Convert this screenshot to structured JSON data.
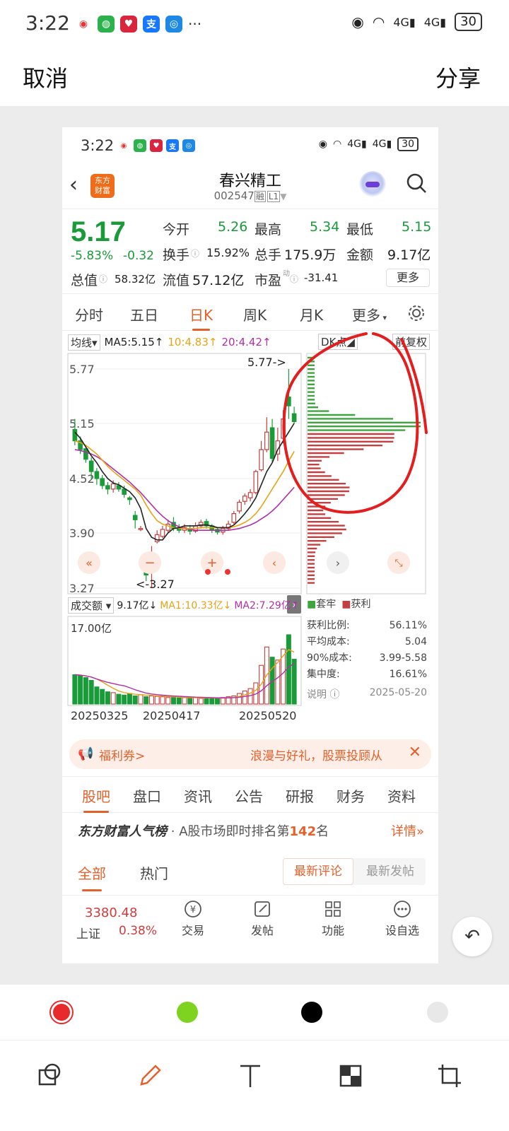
{
  "outer_status": {
    "time": "3:22",
    "battery": "30",
    "more": "···"
  },
  "topbar": {
    "cancel": "取消",
    "share": "分享"
  },
  "inner_status": {
    "time": "3:22",
    "battery": "30"
  },
  "stock": {
    "brand_line1": "东方",
    "brand_line2": "财富",
    "name": "春兴精工",
    "code": "002547",
    "tag": "融",
    "level": "L1"
  },
  "quote": {
    "price": "5.17",
    "change_pct": "-5.83%",
    "change": "-0.32",
    "open_label": "今开",
    "open": "5.26",
    "high_label": "最高",
    "high": "5.34",
    "low_label": "最低",
    "low": "5.15",
    "turnover_label": "换手",
    "turnover": "15.92%",
    "volume_label": "总手",
    "volume": "175.9万",
    "amount_label": "金额",
    "amount": "9.17亿",
    "mcap_label": "总值",
    "mcap": "58.32亿",
    "float_label": "流值",
    "float": "57.12亿",
    "pe_label": "市盈",
    "pe_sup": "动",
    "pe": "-31.41",
    "more": "更多"
  },
  "ktabs": [
    "分时",
    "五日",
    "日K",
    "周K",
    "月K",
    "更多"
  ],
  "ktab_active": "日K",
  "ma": {
    "select": "均线",
    "ma5": "MA5:5.15",
    "ma10": "10:4.83",
    "ma20": "20:4.42"
  },
  "dk": {
    "select": "DK点",
    "fq": "前复权"
  },
  "chart_data": {
    "type": "candlestick",
    "y_ticks": [
      "5.77",
      "5.15",
      "4.52",
      "3.90",
      "3.27"
    ],
    "max_label": "5.77->",
    "min_label": "<-3.27",
    "x_ticks": [
      "20250325",
      "20250417",
      "20250520"
    ],
    "candles": [
      {
        "o": 5.08,
        "c": 4.95,
        "h": 5.2,
        "l": 4.9
      },
      {
        "o": 4.95,
        "c": 4.85,
        "h": 5.0,
        "l": 4.8
      },
      {
        "o": 4.86,
        "c": 4.74,
        "h": 4.9,
        "l": 4.7
      },
      {
        "o": 4.72,
        "c": 4.6,
        "h": 4.76,
        "l": 4.52
      },
      {
        "o": 4.6,
        "c": 4.52,
        "h": 4.64,
        "l": 4.45
      },
      {
        "o": 4.52,
        "c": 4.44,
        "h": 4.56,
        "l": 4.4
      },
      {
        "o": 4.44,
        "c": 4.4,
        "h": 4.48,
        "l": 4.34
      },
      {
        "o": 4.4,
        "c": 4.46,
        "h": 4.5,
        "l": 4.36
      },
      {
        "o": 4.44,
        "c": 4.4,
        "h": 4.48,
        "l": 4.37
      },
      {
        "o": 4.4,
        "c": 4.34,
        "h": 4.44,
        "l": 4.3
      },
      {
        "o": 4.3,
        "c": 4.28,
        "h": 4.32,
        "l": 4.22
      },
      {
        "o": 4.1,
        "c": 4.05,
        "h": 4.15,
        "l": 3.95
      },
      {
        "o": 3.95,
        "c": 3.95,
        "h": 3.98,
        "l": 3.92
      },
      {
        "o": 3.55,
        "c": 3.42,
        "h": 3.6,
        "l": 3.35
      },
      {
        "o": 3.45,
        "c": 3.62,
        "h": 3.75,
        "l": 3.27
      },
      {
        "o": 3.8,
        "c": 3.88,
        "h": 3.93,
        "l": 3.78
      },
      {
        "o": 3.86,
        "c": 3.94,
        "h": 3.98,
        "l": 3.84
      },
      {
        "o": 3.93,
        "c": 4.0,
        "h": 4.05,
        "l": 3.9
      },
      {
        "o": 4.02,
        "c": 3.95,
        "h": 4.08,
        "l": 3.92
      },
      {
        "o": 3.96,
        "c": 3.93,
        "h": 4.0,
        "l": 3.9
      },
      {
        "o": 3.93,
        "c": 3.96,
        "h": 4.0,
        "l": 3.9
      },
      {
        "o": 3.95,
        "c": 3.92,
        "h": 3.99,
        "l": 3.88
      },
      {
        "o": 3.92,
        "c": 3.98,
        "h": 4.02,
        "l": 3.9
      },
      {
        "o": 3.98,
        "c": 4.02,
        "h": 4.05,
        "l": 3.95
      },
      {
        "o": 4.03,
        "c": 3.98,
        "h": 4.06,
        "l": 3.95
      },
      {
        "o": 3.98,
        "c": 3.93,
        "h": 4.0,
        "l": 3.9
      },
      {
        "o": 3.94,
        "c": 3.91,
        "h": 3.96,
        "l": 3.88
      },
      {
        "o": 3.91,
        "c": 3.95,
        "h": 3.98,
        "l": 3.88
      },
      {
        "o": 3.95,
        "c": 4.0,
        "h": 4.04,
        "l": 3.93
      },
      {
        "o": 4.02,
        "c": 4.12,
        "h": 4.15,
        "l": 4.0
      },
      {
        "o": 4.15,
        "c": 4.25,
        "h": 4.28,
        "l": 4.12
      },
      {
        "o": 4.26,
        "c": 4.32,
        "h": 4.35,
        "l": 4.22
      },
      {
        "o": 4.3,
        "c": 4.36,
        "h": 4.4,
        "l": 4.26
      },
      {
        "o": 4.36,
        "c": 4.6,
        "h": 4.62,
        "l": 4.34
      },
      {
        "o": 4.62,
        "c": 4.85,
        "h": 4.95,
        "l": 4.6
      },
      {
        "o": 4.85,
        "c": 5.05,
        "h": 5.22,
        "l": 4.82
      },
      {
        "o": 5.1,
        "c": 4.75,
        "h": 5.2,
        "l": 4.7
      },
      {
        "o": 4.8,
        "c": 4.95,
        "h": 5.1,
        "l": 4.72
      },
      {
        "o": 4.98,
        "c": 5.2,
        "h": 5.3,
        "l": 4.92
      },
      {
        "o": 5.45,
        "c": 5.35,
        "h": 5.77,
        "l": 5.2
      },
      {
        "o": 5.26,
        "c": 5.17,
        "h": 5.34,
        "l": 5.15
      }
    ],
    "ma5": [
      5.05,
      4.98,
      4.88,
      4.78,
      4.7,
      4.6,
      4.52,
      4.47,
      4.45,
      4.41,
      4.37,
      4.3,
      4.18,
      3.95,
      3.85,
      3.82,
      3.82,
      3.9,
      3.95,
      3.96,
      3.98,
      3.98,
      3.98,
      3.99,
      3.99,
      3.98,
      3.96,
      3.96,
      3.96,
      3.99,
      4.05,
      4.12,
      4.2,
      4.3,
      4.45,
      4.6,
      4.7,
      4.85,
      4.95,
      5.05,
      5.15
    ],
    "ma10": [
      4.95,
      4.93,
      4.9,
      4.85,
      4.8,
      4.73,
      4.66,
      4.6,
      4.55,
      4.5,
      4.45,
      4.4,
      4.33,
      4.22,
      4.12,
      4.04,
      4.0,
      3.98,
      3.96,
      3.95,
      3.95,
      3.95,
      3.95,
      3.96,
      3.96,
      3.96,
      3.96,
      3.96,
      3.96,
      3.97,
      3.99,
      4.02,
      4.06,
      4.12,
      4.2,
      4.3,
      4.4,
      4.5,
      4.6,
      4.72,
      4.83
    ],
    "ma20": [
      4.85,
      4.84,
      4.82,
      4.8,
      4.77,
      4.73,
      4.68,
      4.63,
      4.58,
      4.53,
      4.48,
      4.42,
      4.36,
      4.29,
      4.22,
      4.15,
      4.09,
      4.04,
      4.0,
      3.97,
      3.95,
      3.94,
      3.93,
      3.93,
      3.93,
      3.93,
      3.93,
      3.93,
      3.93,
      3.94,
      3.95,
      3.97,
      3.99,
      4.02,
      4.06,
      4.1,
      4.15,
      4.21,
      4.28,
      4.35,
      4.42
    ],
    "volume_label": "成交额",
    "volume_value": "9.17亿",
    "vol_ma1": "MA1:10.33亿",
    "vol_ma2": "MA2:7.29亿",
    "volume_axis_max": "17.00亿",
    "volumes": [
      7.2,
      7.0,
      6.5,
      5.8,
      4.2,
      3.6,
      3.0,
      2.8,
      2.4,
      2.2,
      2.6,
      2.0,
      2.3,
      1.8,
      2.0,
      1.9,
      1.8,
      1.6,
      1.7,
      1.5,
      1.6,
      1.5,
      1.6,
      1.4,
      1.5,
      1.5,
      1.3,
      1.6,
      1.8,
      2.0,
      2.6,
      3.2,
      3.8,
      5.2,
      9.5,
      14.0,
      11.5,
      10.8,
      13.5,
      17.0,
      11.0
    ],
    "cost_distribution": {
      "legend_trapped": "套牢",
      "legend_profit": "获利",
      "profit_ratio_label": "获利比例:",
      "profit_ratio": "56.11%",
      "avg_cost_label": "平均成本:",
      "avg_cost": "5.04",
      "cost90_label": "90%成本:",
      "cost90": "3.99-5.58",
      "concentration_label": "集中度:",
      "concentration": "16.61%",
      "note_label": "说明",
      "date": "2025-05-20"
    }
  },
  "banner": {
    "left": "福利券>",
    "right": "浪漫与好礼，股票投顾从"
  },
  "btabs": [
    "股吧",
    "盘口",
    "资讯",
    "公告",
    "研报",
    "财务",
    "资料"
  ],
  "rank": {
    "brand": "东方财富人气榜",
    "text": "A股市场即时排名第",
    "num": "142",
    "suffix": "名",
    "detail": "详情»"
  },
  "ftabs": [
    "全部",
    "热门"
  ],
  "sort": {
    "latest_comment": "最新评论",
    "latest_post": "最新发帖"
  },
  "bottombar": {
    "index_value": "3380.48",
    "index_name": "上证",
    "index_change": "0.38%",
    "items": [
      "交易",
      "发帖",
      "功能",
      "设自选"
    ]
  },
  "palette": {
    "red": "#e82a2a",
    "green": "#7ed321",
    "black": "#000000",
    "light": "#e8e8e8"
  },
  "tools": [
    "layers-icon",
    "pencil-icon",
    "text-icon",
    "mosaic-icon",
    "crop-icon"
  ]
}
